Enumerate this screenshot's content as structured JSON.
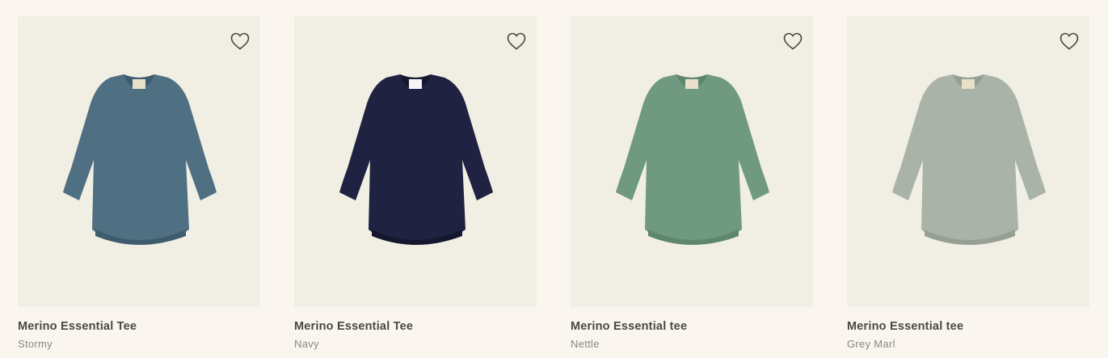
{
  "products": [
    {
      "name": "Merino Essential Tee",
      "color_name": "Stormy",
      "garment_color": "#4f6f82",
      "garment_shade": "#3f5c6e",
      "icon": "heart-outline-icon"
    },
    {
      "name": "Merino Essential Tee",
      "color_name": "Navy",
      "garment_color": "#1f2240",
      "garment_shade": "#15172e",
      "icon": "heart-outline-icon"
    },
    {
      "name": "Merino Essential tee",
      "color_name": "Nettle",
      "garment_color": "#6f9a80",
      "garment_shade": "#5d876d",
      "icon": "heart-outline-icon"
    },
    {
      "name": "Merino Essential tee",
      "color_name": "Grey Marl",
      "garment_color": "#a9b3a8",
      "garment_shade": "#959f94",
      "icon": "heart-outline-icon"
    }
  ]
}
